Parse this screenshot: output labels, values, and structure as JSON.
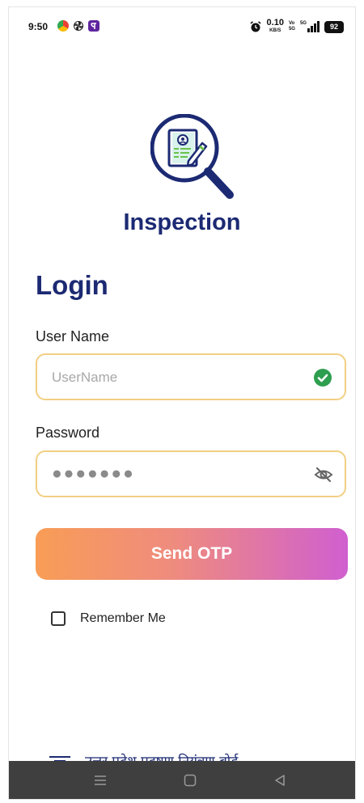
{
  "status_bar": {
    "time": "9:50",
    "net_speed": "0.10",
    "net_unit": "KB/S",
    "volte_top": "Vo",
    "volte_bottom": "5G",
    "network": "5G",
    "battery": "92",
    "icons": [
      "chrome-icon",
      "pinwheel-icon",
      "phonepe-icon",
      "alarm-icon",
      "signal-icon"
    ]
  },
  "app": {
    "title": "Inspection",
    "logo_icon": "inspection-magnifier-document-icon"
  },
  "login": {
    "heading": "Login",
    "username_label": "User Name",
    "username_placeholder": "UserName",
    "username_status_icon": "check-circle-icon",
    "password_label": "Password",
    "password_masked": "●●●●●●●",
    "password_toggle_icon": "eye-off-icon",
    "send_otp_label": "Send OTP",
    "remember_label": "Remember Me",
    "remember_checked": false
  },
  "footer": {
    "org_text": "उत्तर प्रदेश प्रदूषण नियंत्रण बोर्ड"
  },
  "nav": {
    "buttons": [
      "menu-icon",
      "home-icon",
      "back-icon"
    ]
  },
  "colors": {
    "primary": "#1c2a73",
    "input_border": "#f1cf83",
    "success": "#2e9e4f",
    "button_gradient_start": "#f89d56",
    "button_gradient_end": "#d05fd0"
  }
}
